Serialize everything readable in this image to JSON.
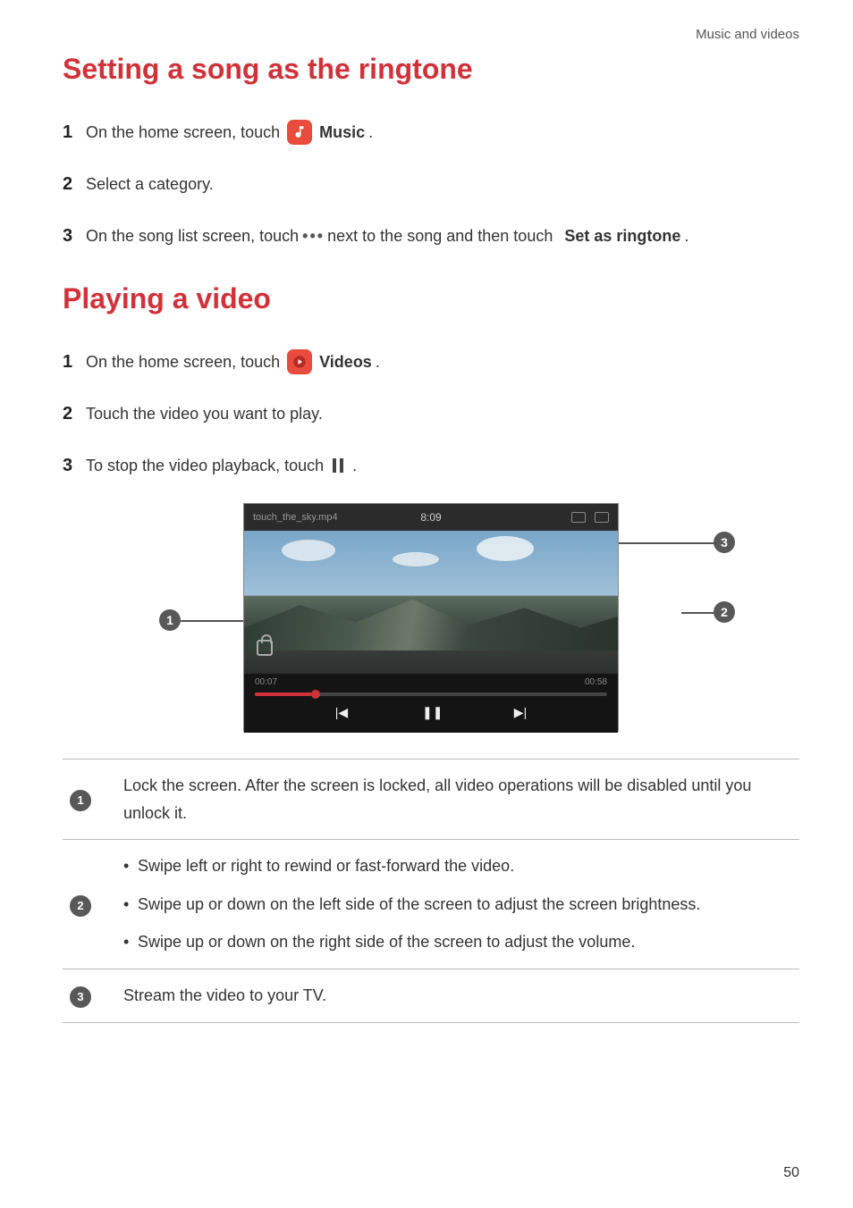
{
  "running_head": "Music and videos",
  "section1": {
    "title": "Setting a song as the ringtone",
    "steps": [
      {
        "pre": "On the home screen, touch",
        "icon": "music-app-icon",
        "post_bold": "Music",
        "tail": "."
      },
      {
        "full": "Select a category."
      },
      {
        "pre": "On the song list screen, touch",
        "icon": "more-dots-icon",
        "mid": "next to the song and then touch",
        "post_bold": "Set as ringtone",
        "tail": "."
      }
    ]
  },
  "section2": {
    "title": "Playing a video",
    "steps": [
      {
        "pre": "On the home screen, touch",
        "icon": "videos-app-icon",
        "post_bold": "Videos",
        "tail": "."
      },
      {
        "full": "Touch the video you want to play."
      },
      {
        "pre": "To stop the video playback, touch",
        "icon": "pause-icon",
        "tail": "."
      }
    ]
  },
  "video_mock": {
    "title": "touch_the_sky.mp4",
    "timestamp_center": "8:09",
    "time_elapsed": "00:07",
    "time_total": "00:58",
    "controls": {
      "prev": "|◀",
      "pause": "❚❚",
      "next": "▶|"
    },
    "callouts": {
      "c1": "1",
      "c2": "2",
      "c3": "3"
    }
  },
  "feature_table": [
    {
      "num": "1",
      "text": "Lock the screen. After the screen is locked, all video operations will be disabled until you unlock it."
    },
    {
      "num": "2",
      "bullets": [
        "Swipe left or right to rewind or fast-forward the video.",
        "Swipe up or down on the left side of the screen to adjust the screen brightness.",
        "Swipe up or down on the right side of the screen to adjust the volume."
      ]
    },
    {
      "num": "3",
      "text": "Stream the video to your TV."
    }
  ],
  "page_number": "50"
}
